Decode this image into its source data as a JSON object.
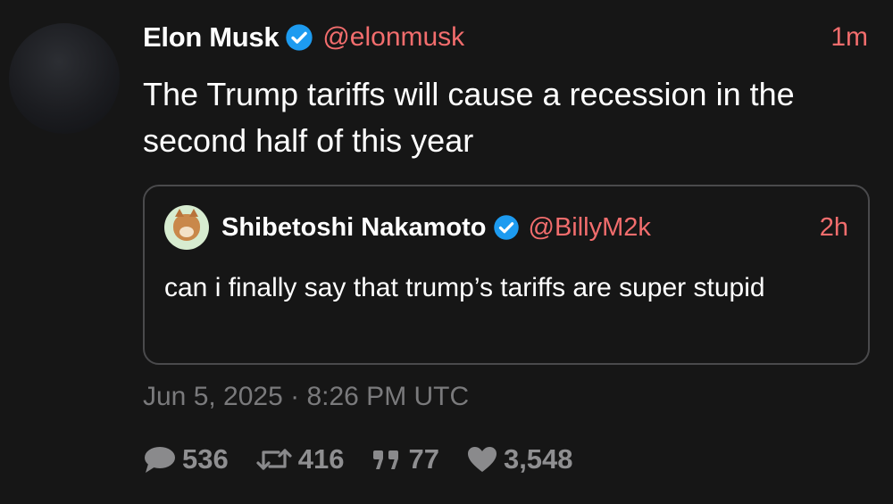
{
  "author": {
    "name": "Elon Musk",
    "handle": "@elonmusk",
    "time": "1m",
    "verified": true
  },
  "tweet_text": "The Trump tariffs will cause a recession in the second half of this year",
  "quoted": {
    "name": "Shibetoshi Nakamoto",
    "handle": "@BillyM2k",
    "time": "2h",
    "verified": true,
    "text": "can i finally say that trump’s tariffs are super stupid"
  },
  "timestamp": "Jun 5, 2025 · 8:26 PM UTC",
  "stats": {
    "replies": "536",
    "retweets": "416",
    "quotes": "77",
    "likes": "3,548"
  },
  "colors": {
    "background": "#161616",
    "accent": "#f26d6d",
    "verified": "#1d9bf0",
    "muted": "#8a8a8c"
  }
}
